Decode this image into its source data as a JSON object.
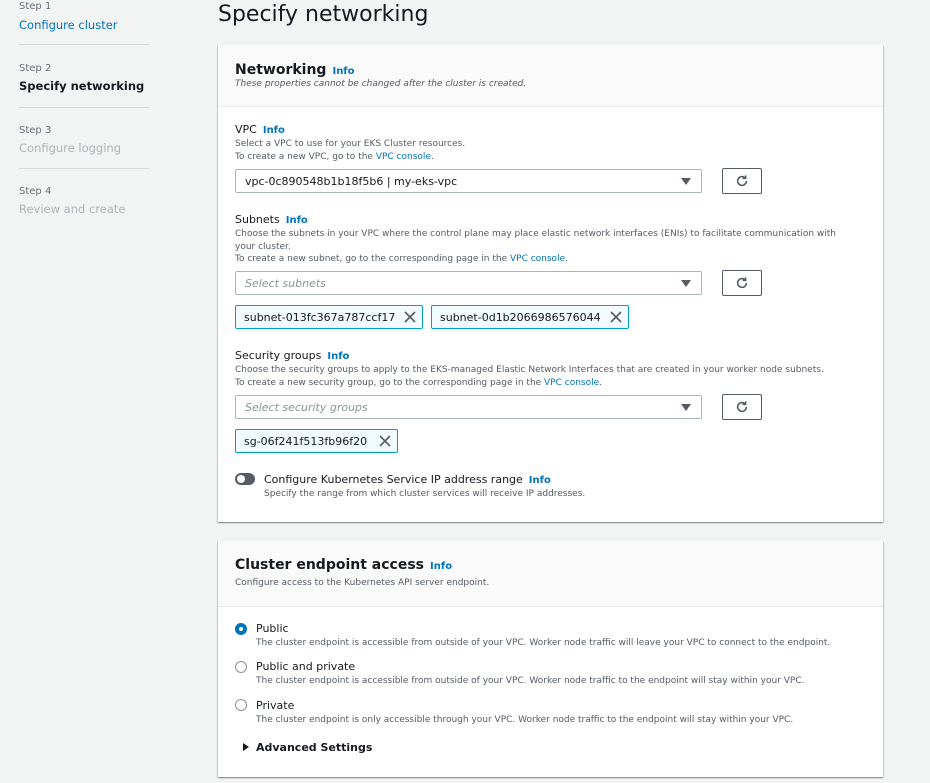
{
  "steps": [
    {
      "number": "Step 1",
      "title": "Configure cluster"
    },
    {
      "number": "Step 2",
      "title": "Specify networking"
    },
    {
      "number": "Step 3",
      "title": "Configure logging"
    },
    {
      "number": "Step 4",
      "title": "Review and create"
    }
  ],
  "page_title": "Specify networking",
  "networking": {
    "title": "Networking",
    "info": "Info",
    "subtitle": "These properties cannot be changed after the cluster is created.",
    "vpc": {
      "label": "VPC",
      "info": "Info",
      "desc_line1": "Select a VPC to use for your EKS Cluster resources.",
      "desc_line2_prefix": "To create a new VPC, go to the ",
      "desc_link": "VPC console",
      "desc_line2_suffix": ".",
      "value": "vpc-0c890548b1b18f5b6 | my-eks-vpc"
    },
    "subnets": {
      "label": "Subnets",
      "info": "Info",
      "desc_line1": "Choose the subnets in your VPC where the control plane may place elastic network interfaces (ENIs) to facilitate communication with your cluster.",
      "desc_line2_prefix": "To create a new subnet, go to the corresponding page in the ",
      "desc_link": "VPC console",
      "desc_line2_suffix": ".",
      "placeholder": "Select subnets",
      "selected": [
        "subnet-013fc367a787ccf17",
        "subnet-0d1b2066986576044"
      ]
    },
    "security_groups": {
      "label": "Security groups",
      "info": "Info",
      "desc_line1": "Choose the security groups to apply to the EKS-managed Elastic Network Interfaces that are created in your worker node subnets.",
      "desc_line2_prefix": "To create a new security group, go to the corresponding page in the ",
      "desc_link": "VPC console",
      "desc_line2_suffix": ".",
      "placeholder": "Select security groups",
      "selected": [
        "sg-06f241f513fb96f20"
      ]
    },
    "service_ip": {
      "label": "Configure Kubernetes Service IP address range",
      "info": "Info",
      "desc": "Specify the range from which cluster services will receive IP addresses.",
      "enabled": false
    }
  },
  "endpoint": {
    "title": "Cluster endpoint access",
    "info": "Info",
    "subtitle": "Configure access to the Kubernetes API server endpoint.",
    "options": [
      {
        "label": "Public",
        "desc": "The cluster endpoint is accessible from outside of your VPC. Worker node traffic will leave your VPC to connect to the endpoint.",
        "selected": true
      },
      {
        "label": "Public and private",
        "desc": "The cluster endpoint is accessible from outside of your VPC. Worker node traffic to the endpoint will stay within your VPC.",
        "selected": false
      },
      {
        "label": "Private",
        "desc": "The cluster endpoint is only accessible through your VPC. Worker node traffic to the endpoint will stay within your VPC.",
        "selected": false
      }
    ],
    "advanced": "Advanced Settings"
  },
  "colors": {
    "accent": "#0073bb",
    "token_border": "#00a1c9",
    "background": "#f2f3f3"
  },
  "icons": {
    "refresh": "refresh-icon",
    "dropdown": "caret-down-icon",
    "remove": "close-icon",
    "expand": "caret-right-icon"
  }
}
